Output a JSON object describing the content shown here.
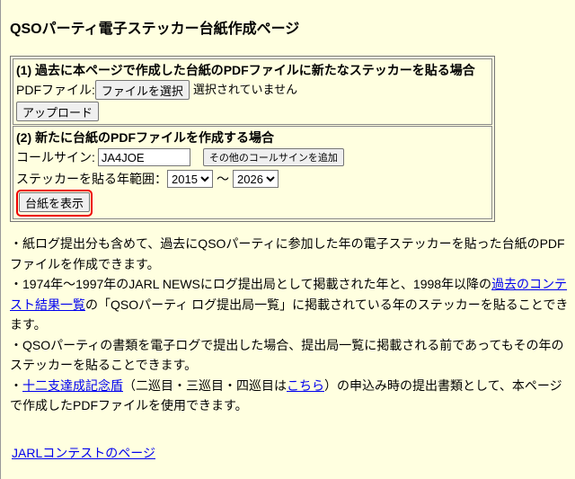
{
  "title": "QSOパーティ電子ステッカー台紙作成ページ",
  "section1": {
    "heading": "(1) 過去に本ページで作成した台紙のPDFファイルに新たなステッカーを貼る場合",
    "file_label": "PDFファイル:",
    "choose_button": "ファイルを選択",
    "no_file": "選択されていません",
    "upload_button": "アップロード"
  },
  "section2": {
    "heading": "(2) 新たに台紙のPDFファイルを作成する場合",
    "callsign_label": "コールサイン:",
    "callsign_value": "JA4JOE",
    "add_callsign_button": "その他のコールサインを追加",
    "range_label": "ステッカーを貼る年範囲：",
    "year_from": "2015",
    "tilde": "～",
    "year_to": "2026",
    "show_button": "台紙を表示"
  },
  "notes": {
    "n1": "・紙ログ提出分も含めて、過去にQSOパーティに参加した年の電子ステッカーを貼った台紙のPDFファイルを作成できます。",
    "n2a": "・1974年～1997年のJARL NEWSにログ提出局として掲載された年と、1998年以降の",
    "n2link": "過去のコンテスト結果一覧",
    "n2b": "の「QSOパーティ ログ提出局一覧」に掲載されている年のステッカーを貼ることできます。",
    "n3": "・QSOパーティの書類を電子ログで提出した場合、提出局一覧に掲載される前であってもその年のステッカーを貼ることできます。",
    "n4a": "・",
    "n4link1": "十二支達成記念盾",
    "n4b": "（二巡目・三巡目・四巡目は",
    "n4link2": "こちら",
    "n4c": "）の申込み時の提出書類として、本ページで作成したPDFファイルを使用できます。"
  },
  "footer_link": "JARLコンテストのページ"
}
